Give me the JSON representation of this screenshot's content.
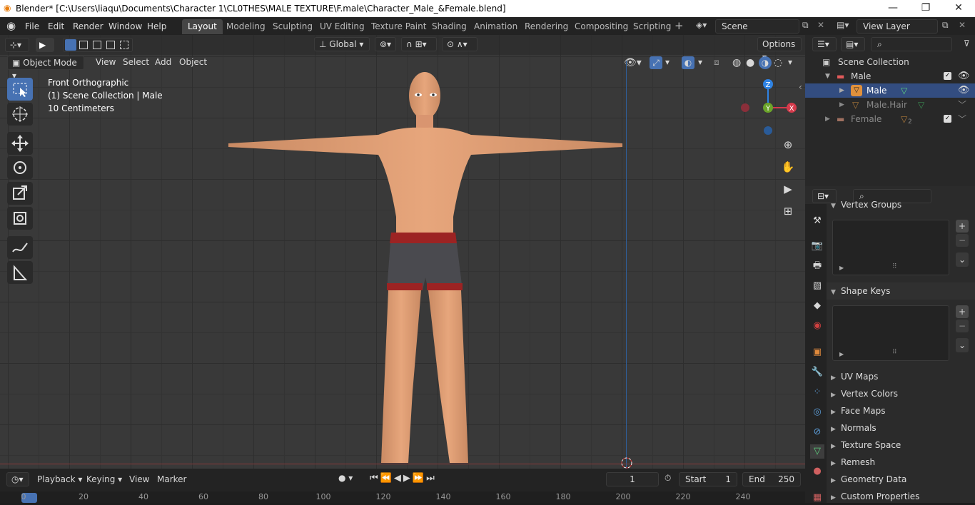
{
  "window": {
    "title": "Blender* [C:\\Users\\liaqu\\Documents\\Character 1\\CL0THES\\MALE TEXTURE\\F.male\\Character_Male_&Female.blend]",
    "minimize": "—",
    "maximize": "❐",
    "close": "✕"
  },
  "menu": {
    "file": "File",
    "edit": "Edit",
    "render": "Render",
    "window": "Window",
    "help": "Help"
  },
  "workspaces": [
    "Layout",
    "Modeling",
    "Sculpting",
    "UV Editing",
    "Texture Paint",
    "Shading",
    "Animation",
    "Rendering",
    "Compositing",
    "Scripting"
  ],
  "scene": {
    "name": "Scene",
    "view_layer": "View Layer"
  },
  "viewport": {
    "mode": "Object Mode",
    "menu": [
      "View",
      "Select",
      "Add",
      "Object"
    ],
    "orientation": "Global",
    "options": "Options",
    "overlay": {
      "view": "Front Orthographic",
      "collection": "(1) Scene Collection | Male",
      "scale": "10 Centimeters"
    },
    "gizmo": {
      "z": "Z",
      "y": "Y",
      "x": "X"
    },
    "colors": {
      "x": "#d53a4b",
      "y": "#6ba42a",
      "z": "#2f83e4",
      "tool_active": "#4772b3"
    }
  },
  "toolbar": [
    "select-box",
    "cursor",
    "move",
    "rotate",
    "scale",
    "transform",
    "annotate",
    "measure"
  ],
  "timeline": {
    "menus": [
      "Playback",
      "Keying",
      "View",
      "Marker"
    ],
    "current_frame": "1",
    "start_label": "Start",
    "start": "1",
    "end_label": "End",
    "end": "250",
    "ticks": [
      "0",
      "20",
      "40",
      "60",
      "80",
      "100",
      "120",
      "140",
      "160",
      "180",
      "200",
      "220",
      "240"
    ]
  },
  "outliner": {
    "root": "Scene Collection",
    "items": [
      {
        "name": "Male",
        "type": "collection"
      },
      {
        "name": "Male",
        "type": "mesh"
      },
      {
        "name": "Male.Hair",
        "type": "mesh"
      },
      {
        "name": "Female",
        "type": "collection",
        "badge": "2"
      }
    ]
  },
  "properties": {
    "sections": {
      "vertex_groups": "Vertex Groups",
      "shape_keys": "Shape Keys",
      "uv_maps": "UV Maps",
      "vertex_colors": "Vertex Colors",
      "face_maps": "Face Maps",
      "normals": "Normals",
      "texture_space": "Texture Space",
      "remesh": "Remesh",
      "geometry_data": "Geometry Data",
      "custom_properties": "Custom Properties"
    }
  }
}
